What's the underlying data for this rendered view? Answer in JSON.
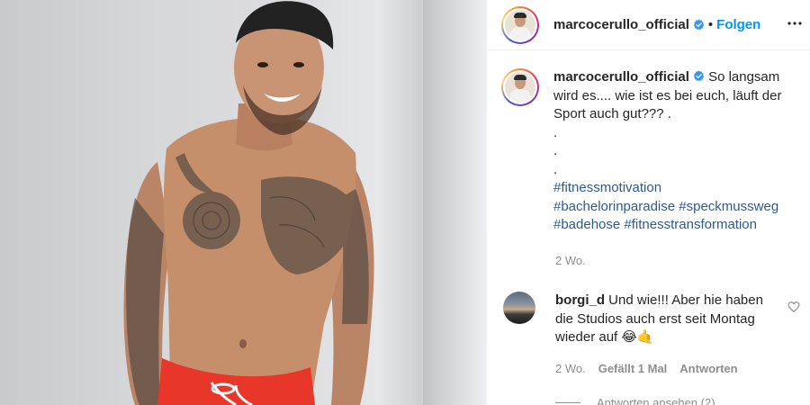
{
  "post": {
    "username": "marcocerullo_official",
    "verified": true,
    "follow_separator": "•",
    "follow_label": "Folgen",
    "caption_text": "So langsam wird es.... wie ist es bei euch, läuft der Sport auch gut??? .",
    "caption_dots": [
      ".",
      ".",
      "."
    ],
    "hashtags_line1": "#fitnessmotivation",
    "hashtags_line2a": "#bachelorinparadise",
    "hashtags_line2b": "#speckmussweg",
    "hashtags_line3a": "#badehose",
    "hashtags_line3b": "#fitnesstransformation",
    "time": "2 Wo."
  },
  "comment": {
    "username": "borgi_d",
    "text": "Und wie!!! Aber hie haben die Studios auch erst seit Montag wieder auf 😂🤙",
    "time": "2 Wo.",
    "likes": "Gefällt 1 Mal",
    "reply_label": "Antworten",
    "view_replies": "Antworten ansehen (2)"
  },
  "icons": {
    "verified": "verified-badge-icon",
    "more": "more-options-icon",
    "heart": "heart-icon"
  },
  "colors": {
    "link": "#0095f6",
    "hashtag": "#2d5b8f",
    "verified": "#3897f0",
    "swim_shorts": "#e8362a"
  }
}
